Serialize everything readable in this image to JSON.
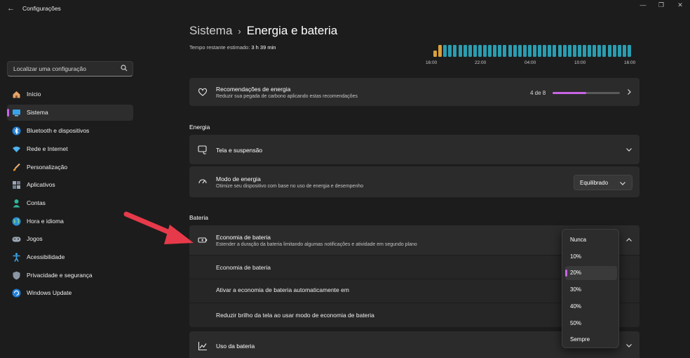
{
  "window": {
    "back_glyph": "←",
    "title": "Configurações",
    "controls": {
      "minimize": "—",
      "restore": "❐",
      "close": "✕"
    }
  },
  "search": {
    "placeholder": "Localizar uma configuração",
    "icon": "search-icon"
  },
  "sidebar": {
    "items": [
      {
        "label": "Início",
        "icon": "home-icon",
        "active": false
      },
      {
        "label": "Sistema",
        "icon": "monitor-icon",
        "active": true
      },
      {
        "label": "Bluetooth e dispositivos",
        "icon": "bluetooth-icon",
        "active": false
      },
      {
        "label": "Rede e Internet",
        "icon": "wifi-icon",
        "active": false
      },
      {
        "label": "Personalização",
        "icon": "brush-icon",
        "active": false
      },
      {
        "label": "Aplicativos",
        "icon": "apps-icon",
        "active": false
      },
      {
        "label": "Contas",
        "icon": "person-icon",
        "active": false
      },
      {
        "label": "Hora e idioma",
        "icon": "globe-icon",
        "active": false
      },
      {
        "label": "Jogos",
        "icon": "gamepad-icon",
        "active": false
      },
      {
        "label": "Acessibilidade",
        "icon": "accessibility-icon",
        "active": false
      },
      {
        "label": "Privacidade e segurança",
        "icon": "shield-icon",
        "active": false
      },
      {
        "label": "Windows Update",
        "icon": "update-icon",
        "active": false
      }
    ]
  },
  "header": {
    "breadcrumb_parent": "Sistema",
    "breadcrumb_sep": "›",
    "breadcrumb_current": "Energia e bateria",
    "remaining_label": "Tempo restante estimado:",
    "remaining_value": "3 h 39 min"
  },
  "battery_chart": {
    "tick_labels": [
      "16:00",
      "22:00",
      "04:00",
      "10:00",
      "16:00"
    ],
    "colors": {
      "past": "#d9a13a",
      "future": "#2a9db0"
    },
    "past_levels": [
      0.55,
      1.0
    ],
    "future_levels": [
      1,
      1,
      1,
      1,
      1,
      1,
      1,
      1,
      1,
      1,
      1,
      1,
      1,
      1,
      1,
      1,
      1,
      1,
      1,
      1,
      1,
      1,
      1,
      1,
      1,
      1,
      1,
      1,
      1,
      1,
      1,
      1,
      1,
      1,
      1,
      1,
      1,
      1
    ]
  },
  "recommendations": {
    "title": "Recomendações de energia",
    "subtitle": "Reduzir sua pegada de carbono aplicando estas recomendações",
    "progress_text": "4 de 8",
    "progress_fraction": 0.5,
    "accent": "#c864e6"
  },
  "energia": {
    "section_title": "Energia",
    "screen_sleep": {
      "title": "Tela e suspensão"
    },
    "power_mode": {
      "title": "Modo de energia",
      "subtitle": "Otimize seu dispositivo com base no uso de energia e desempenho",
      "value": "Equilibrado"
    }
  },
  "bateria": {
    "section_title": "Bateria",
    "saver": {
      "title": "Economia de bateria",
      "subtitle": "Estender a duração da bateria limitando algumas notificações e atividade em segundo plano"
    },
    "sub_rows": [
      "Economia de bateria",
      "Ativar a economia de bateria automaticamente em",
      "Reduzir brilho da tela ao usar modo de economia de bateria"
    ],
    "usage": {
      "title": "Uso da bateria"
    }
  },
  "threshold_menu": {
    "options": [
      "Nunca",
      "10%",
      "20%",
      "30%",
      "40%",
      "50%",
      "Sempre"
    ],
    "selected": "20%"
  },
  "annotation_arrow_color": "#e63a4a"
}
